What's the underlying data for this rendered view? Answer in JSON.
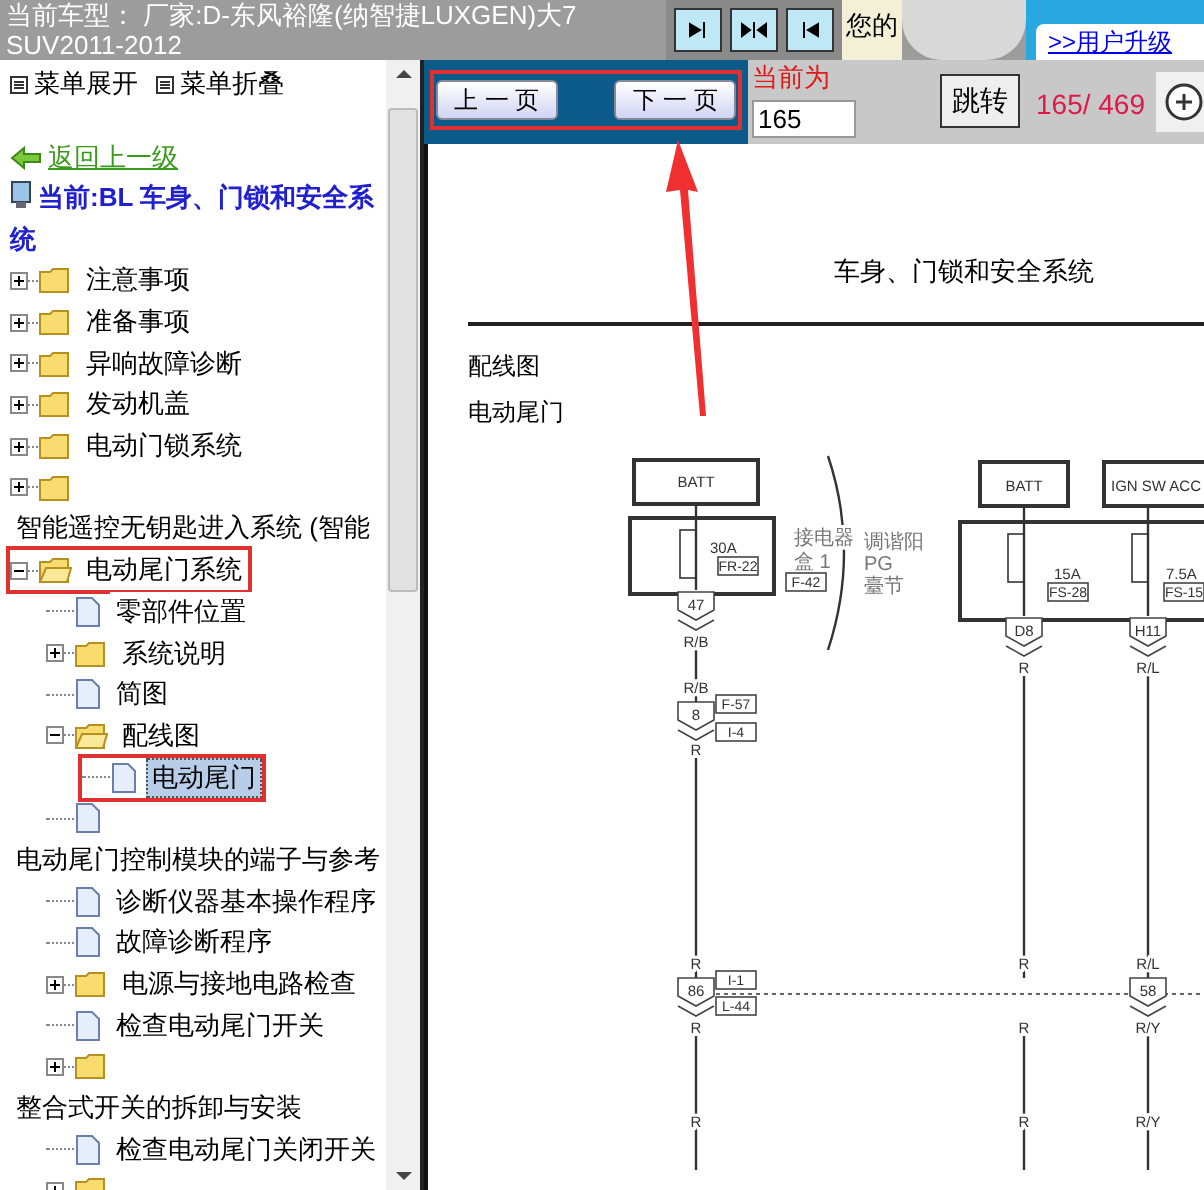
{
  "header": {
    "vehicle": "当前车型：  厂家:D-东风裕隆(纳智捷LUXGEN)大7 SUV2011-2012",
    "greeting": "您的",
    "upgrade_link": ">>用户升级"
  },
  "menu": {
    "expand": "菜单展开",
    "collapse": "菜单折叠",
    "back": "返回上一级",
    "current": "当前:BL 车身、门锁和安全系统"
  },
  "tree": [
    {
      "kind": "folder",
      "label": "注意事项",
      "expanded": false,
      "selected": false,
      "outlined": false,
      "wrap": false
    },
    {
      "kind": "folder",
      "label": "准备事项",
      "expanded": false,
      "selected": false,
      "outlined": false,
      "wrap": false
    },
    {
      "kind": "folder",
      "label": "异响故障诊断",
      "expanded": false,
      "selected": false,
      "outlined": false,
      "wrap": false
    },
    {
      "kind": "folder",
      "label": "发动机盖",
      "expanded": false,
      "selected": false,
      "outlined": false,
      "wrap": false
    },
    {
      "kind": "folder",
      "label": "电动门锁系统",
      "expanded": false,
      "selected": false,
      "outlined": false,
      "wrap": false
    },
    {
      "kind": "folder",
      "label": "智能遥控无钥匙进入系统 (智能",
      "expanded": false,
      "selected": false,
      "outlined": false,
      "wrap": true
    },
    {
      "kind": "folder",
      "label": "电动尾门系统",
      "expanded": true,
      "selected": false,
      "outlined": true,
      "wrap": false,
      "children": [
        {
          "kind": "doc",
          "label": "零部件位置",
          "selected": false,
          "outlined": false,
          "wrap": false
        },
        {
          "kind": "folder",
          "label": "系统说明",
          "expanded": false,
          "selected": false,
          "outlined": false,
          "wrap": false
        },
        {
          "kind": "doc",
          "label": "简图",
          "selected": false,
          "outlined": false,
          "wrap": false
        },
        {
          "kind": "folder",
          "label": "配线图",
          "expanded": true,
          "selected": false,
          "outlined": false,
          "wrap": false,
          "children": [
            {
              "kind": "doc",
              "label": "电动尾门",
              "selected": true,
              "outlined": true,
              "wrap": false
            }
          ]
        },
        {
          "kind": "doc",
          "label": "电动尾门控制模块的端子与参考",
          "selected": false,
          "outlined": false,
          "wrap": true
        },
        {
          "kind": "doc",
          "label": "诊断仪器基本操作程序",
          "selected": false,
          "outlined": false,
          "wrap": false
        },
        {
          "kind": "doc",
          "label": "故障诊断程序",
          "selected": false,
          "outlined": false,
          "wrap": false
        },
        {
          "kind": "folder",
          "label": "电源与接地电路检查",
          "expanded": false,
          "selected": false,
          "outlined": false,
          "wrap": false
        },
        {
          "kind": "doc",
          "label": "检查电动尾门开关",
          "selected": false,
          "outlined": false,
          "wrap": false
        },
        {
          "kind": "folder",
          "label": "整合式开关的拆卸与安装",
          "expanded": false,
          "selected": false,
          "outlined": false,
          "wrap": true
        },
        {
          "kind": "doc",
          "label": "检查电动尾门关闭开关",
          "selected": false,
          "outlined": false,
          "wrap": false
        },
        {
          "kind": "folder",
          "expanded": false,
          "outlined": false
        }
      ]
    }
  ],
  "pager": {
    "prev": "上 一 页",
    "next": "下 一 页",
    "current_label": "当前为",
    "page_input": "165",
    "jump": "跳转",
    "count": "165/ 469"
  },
  "document": {
    "title": "车身、门锁和安全系统",
    "section": "配线图",
    "subsection": "电动尾门",
    "labels": [
      {
        "kind": "text",
        "text": "BATT"
      },
      {
        "kind": "text",
        "text": "30A"
      },
      {
        "kind": "tag",
        "text": "FR-22"
      },
      {
        "kind": "note",
        "text": "接电器"
      },
      {
        "kind": "note",
        "text": "盒 1"
      },
      {
        "kind": "tag",
        "text": "F-42"
      },
      {
        "kind": "note",
        "text": "调谐阳"
      },
      {
        "kind": "note",
        "text": "PG"
      },
      {
        "kind": "note",
        "text": "臺节"
      },
      {
        "kind": "pin",
        "text": "47"
      },
      {
        "kind": "text",
        "text": "R/B"
      },
      {
        "kind": "text",
        "text": "R/B"
      },
      {
        "kind": "pin",
        "text": "8"
      },
      {
        "kind": "tag",
        "text": "F-57"
      },
      {
        "kind": "tag",
        "text": "I-4"
      },
      {
        "kind": "text",
        "text": "R"
      },
      {
        "kind": "text",
        "text": "BATT"
      },
      {
        "kind": "text",
        "text": "IGN SW ACC"
      },
      {
        "kind": "text",
        "text": "15A"
      },
      {
        "kind": "tag",
        "text": "FS-28"
      },
      {
        "kind": "text",
        "text": "7.5A"
      },
      {
        "kind": "tag",
        "text": "FS-15"
      },
      {
        "kind": "pin",
        "text": "D8"
      },
      {
        "kind": "text",
        "text": "R"
      },
      {
        "kind": "pin",
        "text": "H11"
      },
      {
        "kind": "text",
        "text": "R/L"
      },
      {
        "kind": "text",
        "text": "R"
      },
      {
        "kind": "pin",
        "text": "86"
      },
      {
        "kind": "tag",
        "text": "I-1"
      },
      {
        "kind": "tag",
        "text": "L-44"
      },
      {
        "kind": "text",
        "text": "R"
      },
      {
        "kind": "text",
        "text": "R"
      },
      {
        "kind": "text",
        "text": "R"
      },
      {
        "kind": "text",
        "text": "R"
      },
      {
        "kind": "text",
        "text": "R"
      },
      {
        "kind": "text",
        "text": "R/L"
      },
      {
        "kind": "pin",
        "text": "58"
      },
      {
        "kind": "text",
        "text": "R/Y"
      },
      {
        "kind": "text",
        "text": "R/Y"
      }
    ]
  }
}
